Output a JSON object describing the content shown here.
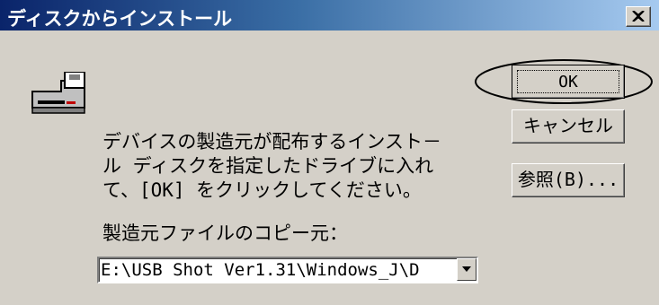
{
  "window": {
    "title": "ディスクからインストール"
  },
  "message": {
    "line1": "デバイスの製造元が配布するインスト－",
    "line2": "ル ディスクを指定したドライブに入れ",
    "line3": "て、[OK] をクリックしてください。"
  },
  "copy_from": {
    "label": "製造元ファイルのコピー元：",
    "value": "E:\\USB Shot Ver1.31\\Windows_J\\D"
  },
  "buttons": {
    "ok": "OK",
    "cancel": "キャンセル",
    "browse": "参照(B)..."
  },
  "icons": {
    "drive": "floppy-drive-icon",
    "close": "close-icon",
    "dropdown": "dropdown-arrow-icon"
  }
}
